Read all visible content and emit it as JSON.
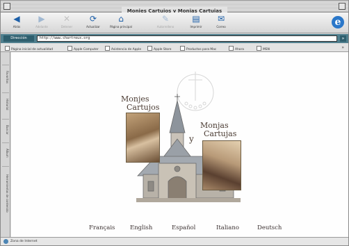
{
  "window": {
    "title": "Monjes Cartujos y Monjas Cartujas"
  },
  "toolbar": {
    "buttons": [
      {
        "label": "Atrás",
        "icon": "back-arrow-icon",
        "glyph": "◀",
        "enabled": true
      },
      {
        "label": "Adelante",
        "icon": "forward-arrow-icon",
        "glyph": "▶",
        "enabled": false
      },
      {
        "label": "Detener",
        "icon": "stop-icon",
        "glyph": "✕",
        "enabled": false
      },
      {
        "label": "Actualizar",
        "icon": "refresh-icon",
        "glyph": "⟳",
        "enabled": true
      },
      {
        "label": "Página principal",
        "icon": "home-icon",
        "glyph": "⌂",
        "enabled": true
      },
      {
        "label": "Autorrelleno",
        "icon": "autofill-icon",
        "glyph": "✎",
        "enabled": false
      },
      {
        "label": "Imprimir",
        "icon": "print-icon",
        "glyph": "▤",
        "enabled": true
      },
      {
        "label": "Correo",
        "icon": "mail-icon",
        "glyph": "✉",
        "enabled": true
      }
    ],
    "logo": "e"
  },
  "address": {
    "label": "Dirección",
    "value": "http://www.chartreux.org",
    "go": "»"
  },
  "favorites": {
    "items": [
      "Página inicial de actualidad",
      "Apple Computer",
      "Asistencia de Apple",
      "Apple Store",
      "Productos para Mac",
      "Ahora",
      "MSN"
    ],
    "more": "»"
  },
  "sidebar": {
    "tabs": [
      "Favoritos",
      "Historial",
      "Buscar",
      "Álbum",
      "Herramientas de contenido"
    ]
  },
  "content": {
    "title_monjes_line1": "Monjes",
    "title_monjes_line2": "Cartujos",
    "title_y": "y",
    "title_monjas_line1": "Monjas",
    "title_monjas_line2": "Cartujas",
    "languages": [
      "Français",
      "English",
      "Español",
      "Italiano",
      "Deutsch"
    ]
  },
  "status": {
    "text": "Zona de Internet"
  },
  "colors": {
    "address_bar": "#4f7f8e",
    "title_ink": "#4a3b32",
    "ie_blue": "#2a77c9"
  }
}
